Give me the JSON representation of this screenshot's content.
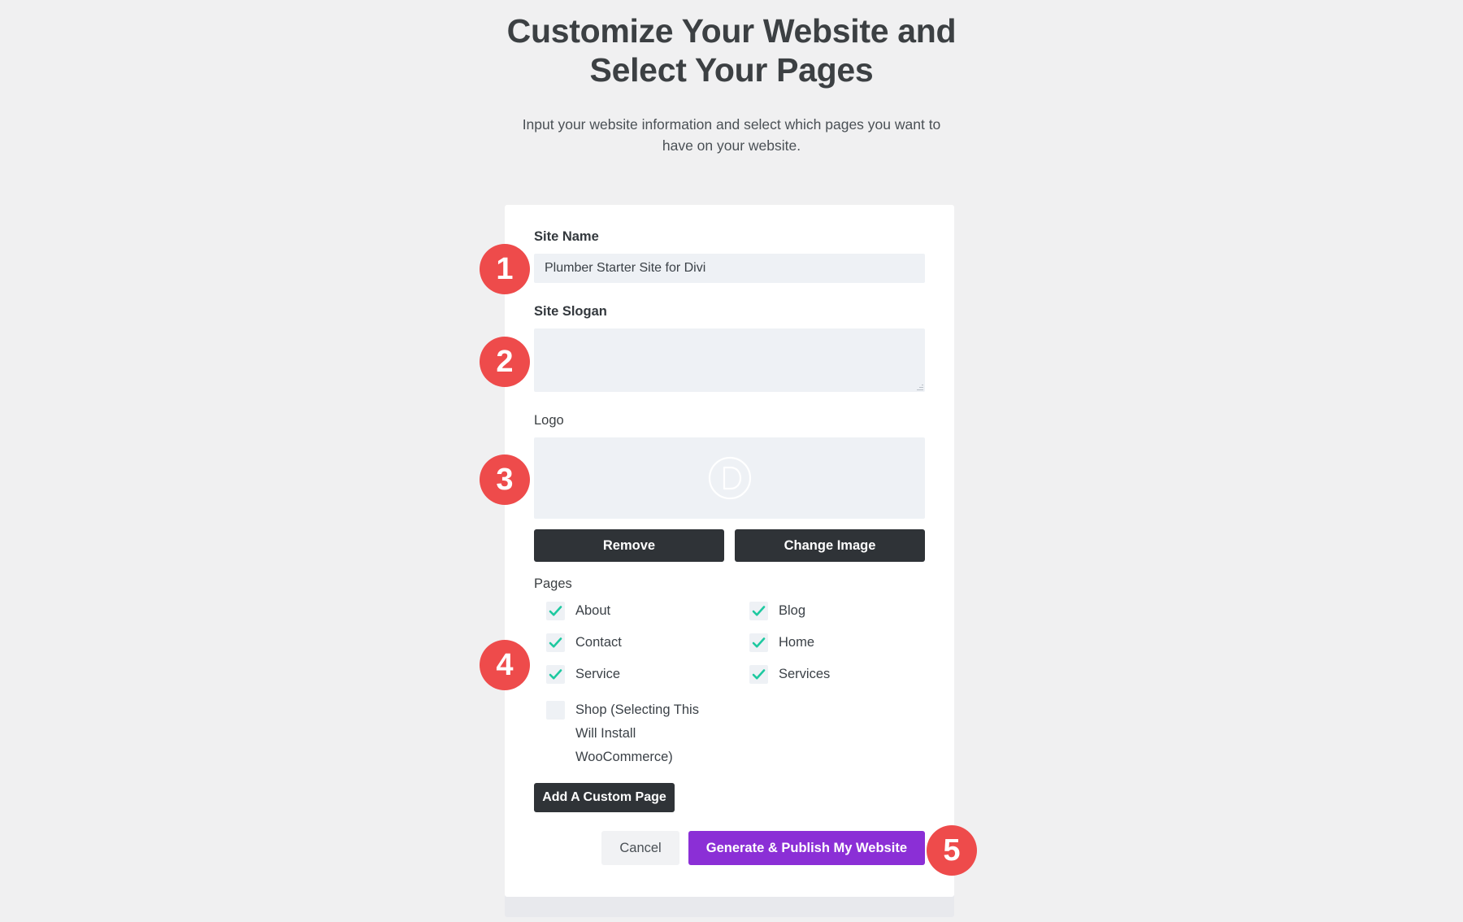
{
  "header": {
    "title": "Customize Your Website and Select Your Pages",
    "subtitle": "Input your website information and select which pages you want to have on your website."
  },
  "form": {
    "site_name": {
      "label": "Site Name",
      "value": "Plumber Starter Site for Divi",
      "placeholder": ""
    },
    "site_slogan": {
      "label": "Site Slogan",
      "value": "",
      "placeholder": ""
    },
    "logo": {
      "label": "Logo",
      "icon": "divi-d-logo-icon",
      "remove_label": "Remove",
      "change_label": "Change Image"
    },
    "pages": {
      "label": "Pages",
      "items": [
        {
          "label": "About",
          "checked": true
        },
        {
          "label": "Blog",
          "checked": true
        },
        {
          "label": "Contact",
          "checked": true
        },
        {
          "label": "Home",
          "checked": true
        },
        {
          "label": "Service",
          "checked": true
        },
        {
          "label": "Services",
          "checked": true
        },
        {
          "label": "Shop (Selecting This Will Install WooCommerce)",
          "checked": false
        }
      ],
      "add_custom_page_label": "Add A Custom Page"
    },
    "footer": {
      "cancel_label": "Cancel",
      "submit_label": "Generate & Publish My Website"
    }
  },
  "annotations": [
    {
      "number": "1"
    },
    {
      "number": "2"
    },
    {
      "number": "3"
    },
    {
      "number": "4"
    },
    {
      "number": "5"
    }
  ],
  "colors": {
    "page_background": "#f0f0f1",
    "card_background": "#ffffff",
    "input_background": "#eef1f5",
    "dark_button": "#2f3337",
    "primary_button": "#8b2fd6",
    "checkmark": "#1ec9a0",
    "badge": "#ee4b4b"
  }
}
